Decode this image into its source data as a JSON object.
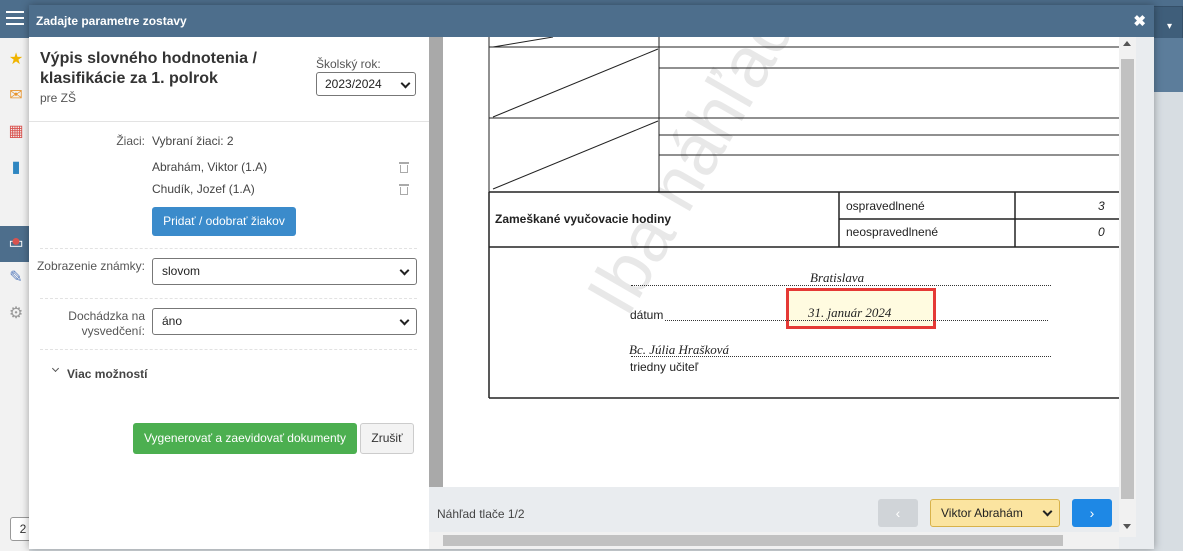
{
  "dialog": {
    "title": "Zadajte parametre zostavy",
    "close_glyph": "✖"
  },
  "report": {
    "title": "Výpis slovného hodnotenia / klasifikácie za 1. polrok",
    "subtitle": "pre ZŠ"
  },
  "school_year": {
    "label": "Školský rok:",
    "value": "2023/2024"
  },
  "students": {
    "label": "Žiaci:",
    "summary": "Vybraní žiaci: 2",
    "list": [
      "Abrahám, Viktor (1.A)",
      "Chudík, Jozef (1.A)"
    ],
    "add_remove_label": "Pridať / odobrať žiakov"
  },
  "grade_display": {
    "label": "Zobrazenie známky:",
    "value": "slovom"
  },
  "attendance": {
    "label": "Dochádzka na vysvedčení:",
    "value": "áno"
  },
  "more_options": {
    "label": "Viac možností"
  },
  "actions": {
    "generate_label": "Vygenerovať a zaevidovať dokumenty",
    "cancel_label": "Zrušiť"
  },
  "preview": {
    "watermark": "Iba náhľad.",
    "absences_label": "Zameškané vyučovacie hodiny",
    "excused_label": "ospravedlnené",
    "excused_value": "3",
    "unexcused_label": "neospravedlnené",
    "unexcused_value": "0",
    "place": "Bratislava",
    "date_label": "dátum",
    "date_value": "31. január 2024",
    "teacher_name": "Bc. Júlia Hrašková",
    "teacher_role": "triedny učiteľ",
    "page_label": "Náhľad tlače 1/2",
    "prev_glyph": "‹",
    "next_glyph": "›",
    "student_selected": "Viktor Abrahám"
  },
  "app": {
    "page_box": "2",
    "sidebar_icons": [
      "star-icon",
      "mail-icon",
      "calendar-icon",
      "book-icon",
      "library-icon",
      "chat-icon",
      "pen-icon",
      "gear-icon"
    ],
    "colors": {
      "header": "#4d6e8c",
      "primary_button": "#3b8bcb",
      "success_button": "#4caf50",
      "next_button": "#1e88e5",
      "highlight": "#e53935",
      "student_select": "#fbe4a0"
    }
  }
}
